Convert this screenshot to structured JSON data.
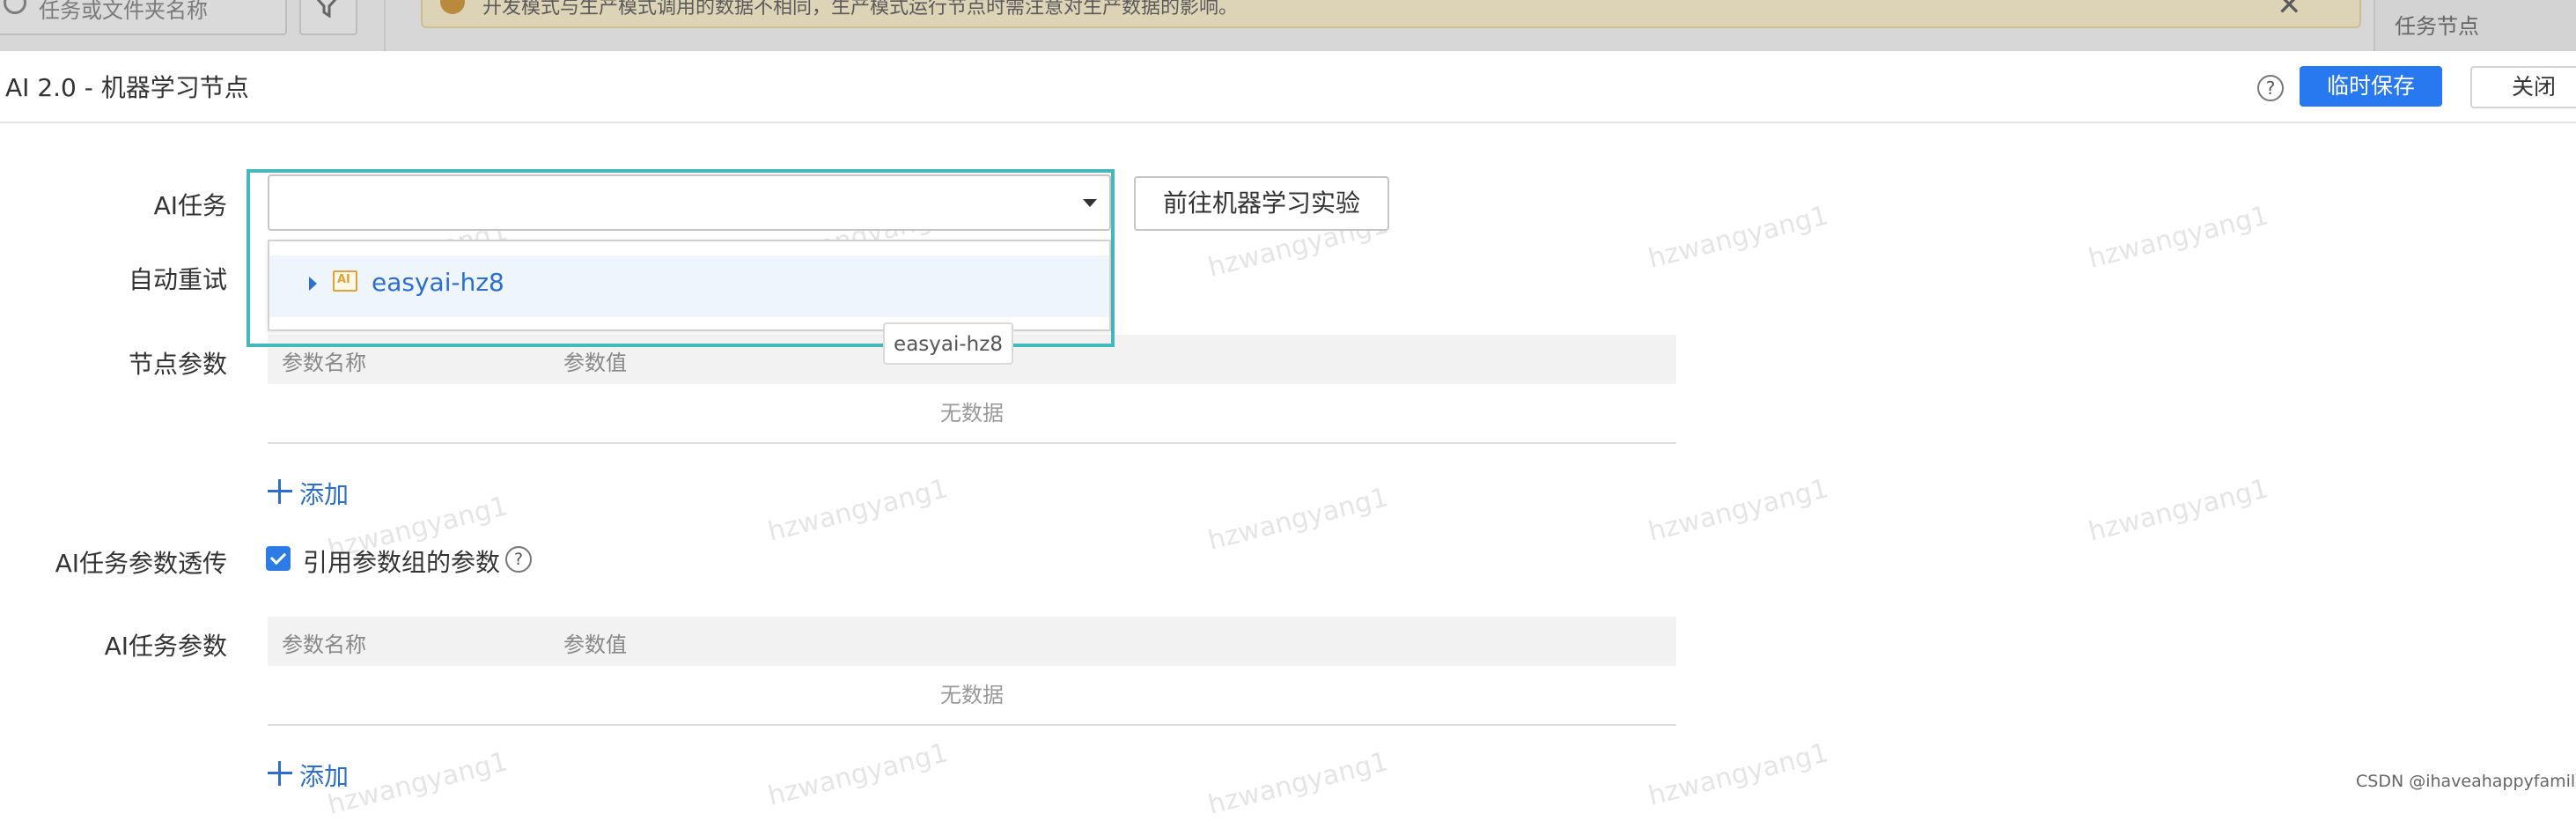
{
  "backdrop": {
    "search_placeholder": "任务或文件夹名称",
    "alert_text": "开发模式与生产模式调用的数据不相同，生产模式运行节点时需注意对生产数据的影响。",
    "right_panel_label": "任务节点"
  },
  "modal": {
    "title": "AI 2.0 - 机器学习节点",
    "help_icon": "?",
    "save_label": "临时保存",
    "close_label": "关闭"
  },
  "form": {
    "ai_task_label": "AI任务",
    "auto_retry_label": "自动重试",
    "node_params_label": "节点参数",
    "passthrough_label": "AI任务参数透传",
    "ai_params_label": "AI任务参数"
  },
  "task_select": {
    "value": "",
    "goto_button": "前往机器学习实验",
    "dropdown_items": [
      {
        "icon": "ai-folder-icon",
        "icon_text": "AI",
        "label": "easyai-hz8"
      }
    ],
    "tooltip": "easyai-hz8"
  },
  "node_params_table": {
    "columns": [
      "参数名称",
      "参数值"
    ],
    "empty_text": "无数据",
    "add_label": "添加"
  },
  "passthrough": {
    "checked": true,
    "checkbox_label": "引用参数组的参数",
    "help_icon": "?"
  },
  "ai_params_table": {
    "columns": [
      "参数名称",
      "参数值"
    ],
    "empty_text": "无数据",
    "add_label": "添加"
  },
  "watermark": "hzwangyang1",
  "credit": "CSDN @ihaveahappyfamily",
  "colors": {
    "primary": "#2878f0",
    "link": "#2c6ed0",
    "focus_outline": "#45b8bd",
    "folder_icon": "#e0a33a"
  }
}
